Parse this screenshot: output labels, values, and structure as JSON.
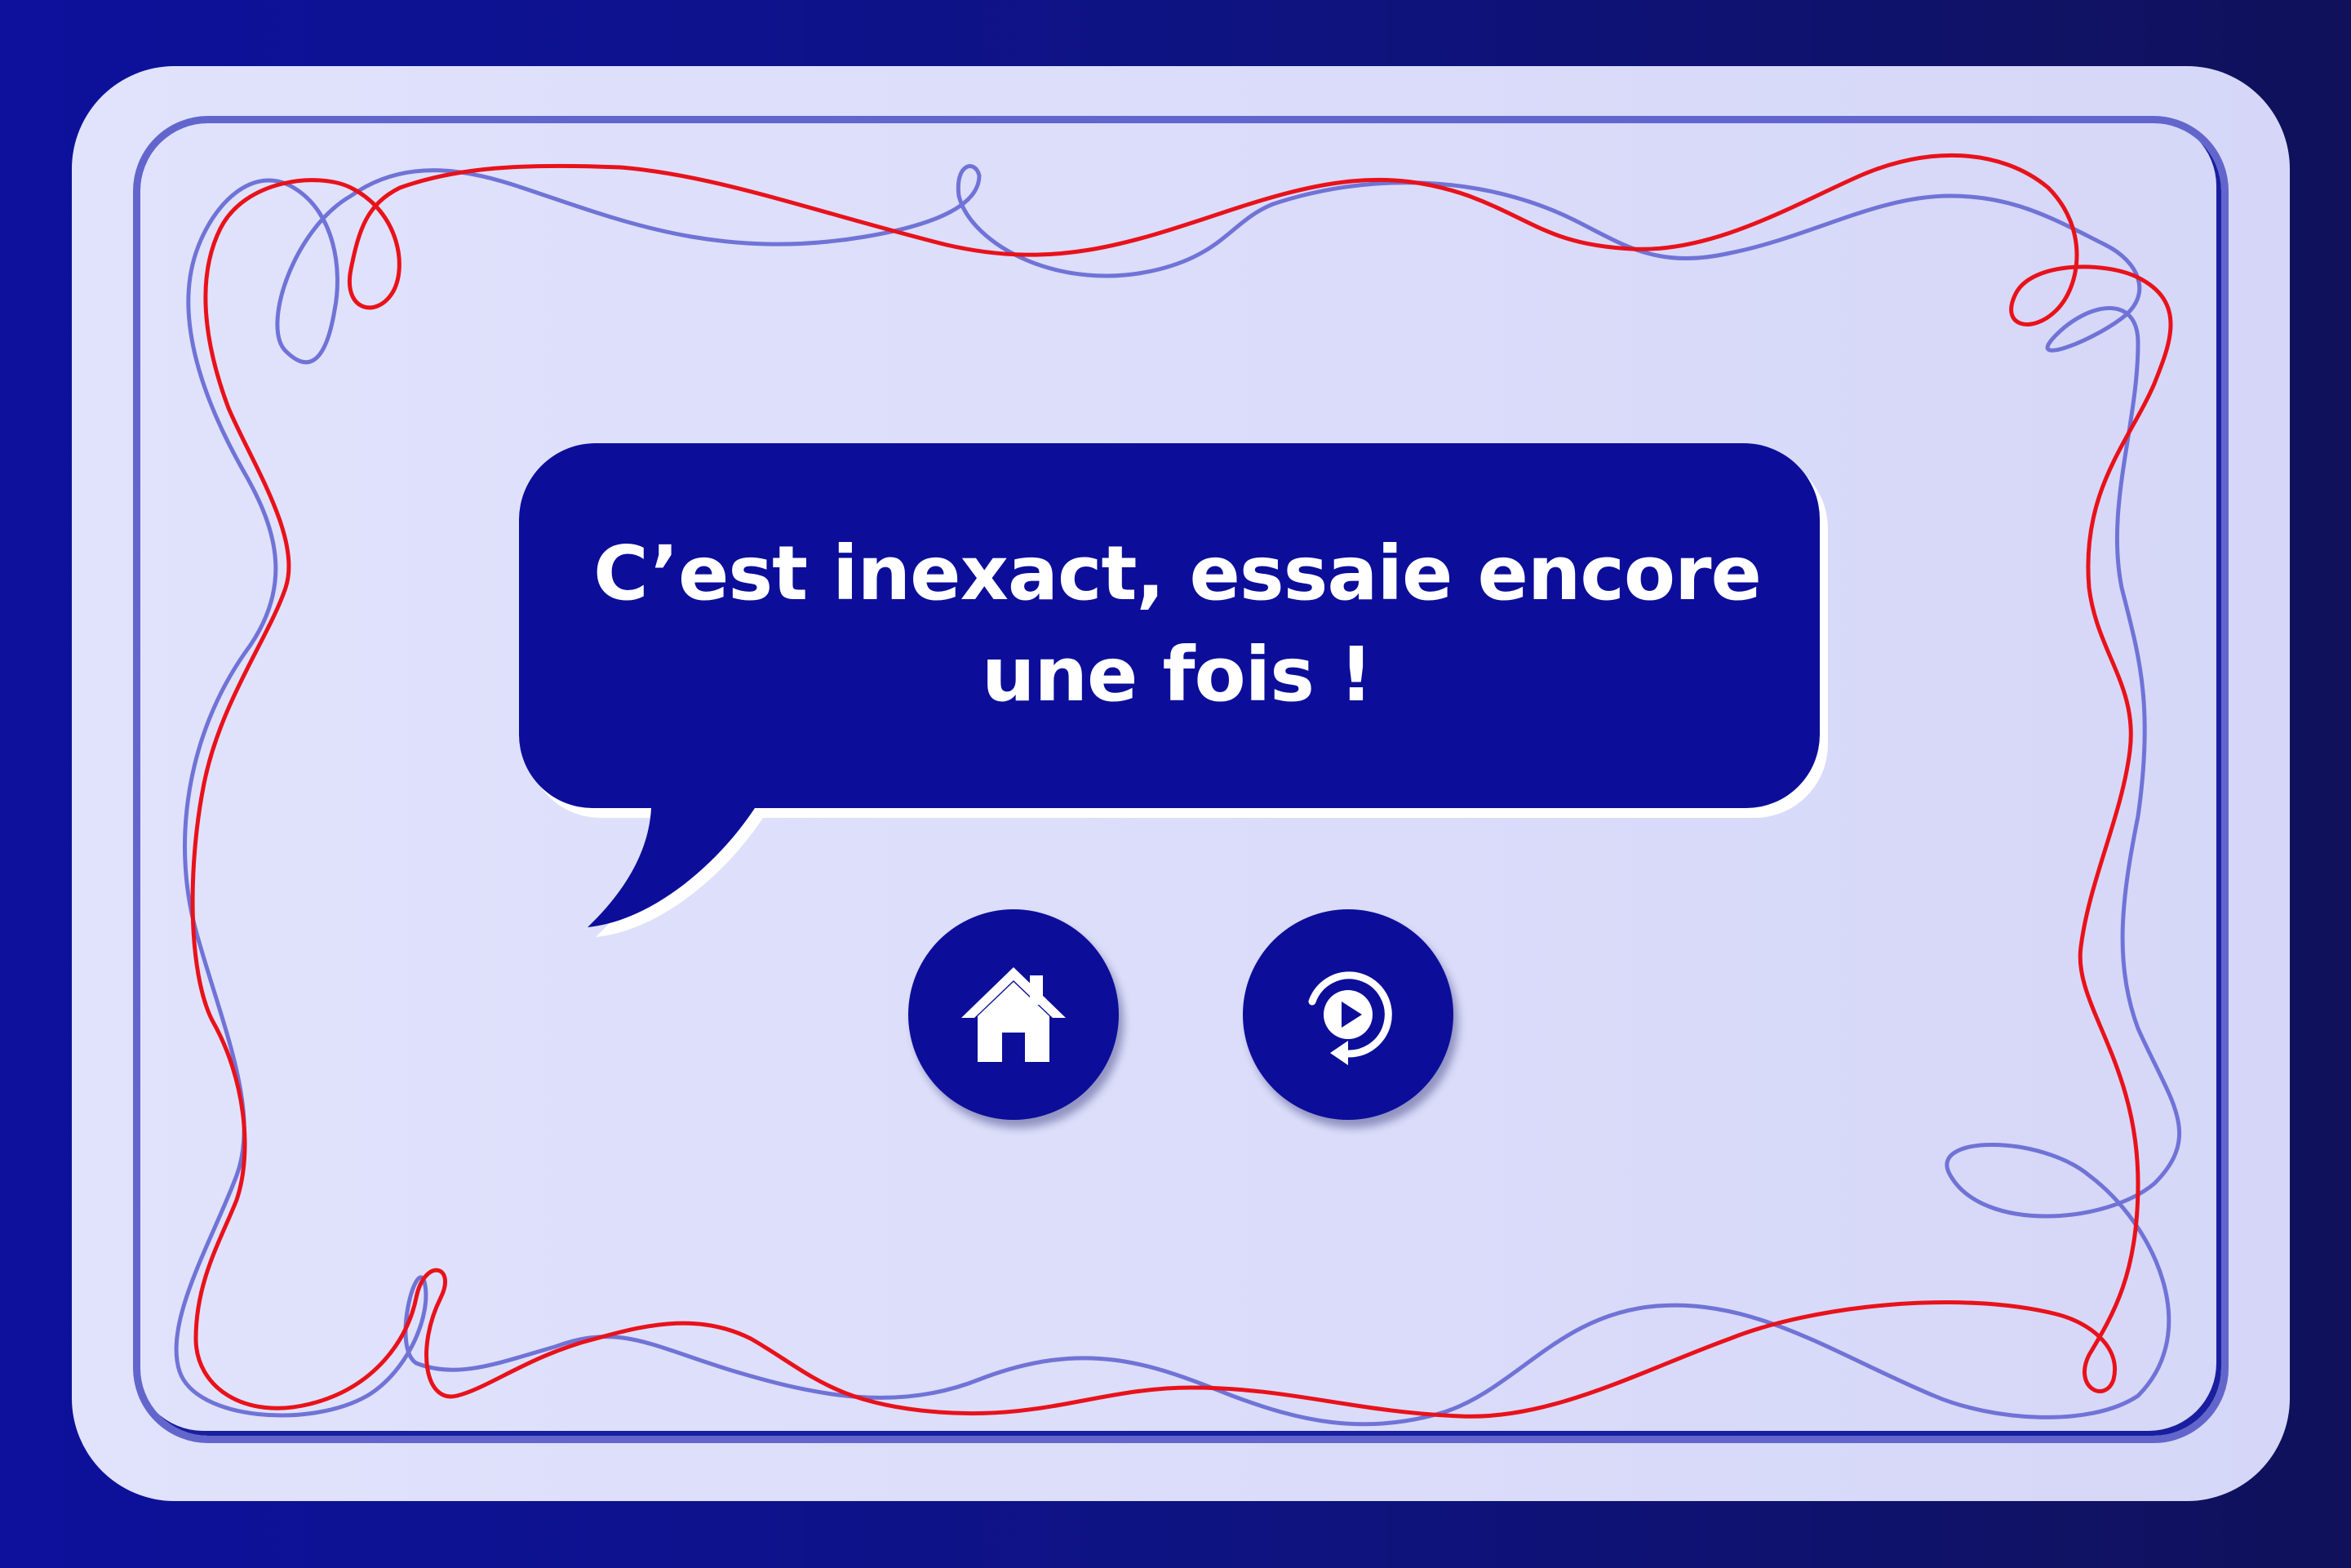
{
  "feedback": {
    "line1": "C’est inexact, essaie encore",
    "line2": "une fois !"
  },
  "buttons": {
    "home": {
      "icon": "home-icon"
    },
    "replay": {
      "icon": "replay-icon"
    }
  },
  "colors": {
    "background": "#0d119c",
    "card": "#dcdefb",
    "frame": "#6266cc",
    "bubble": "#0c0e9a",
    "squiggle_blue": "#7073d6",
    "squiggle_red": "#e8121b"
  }
}
